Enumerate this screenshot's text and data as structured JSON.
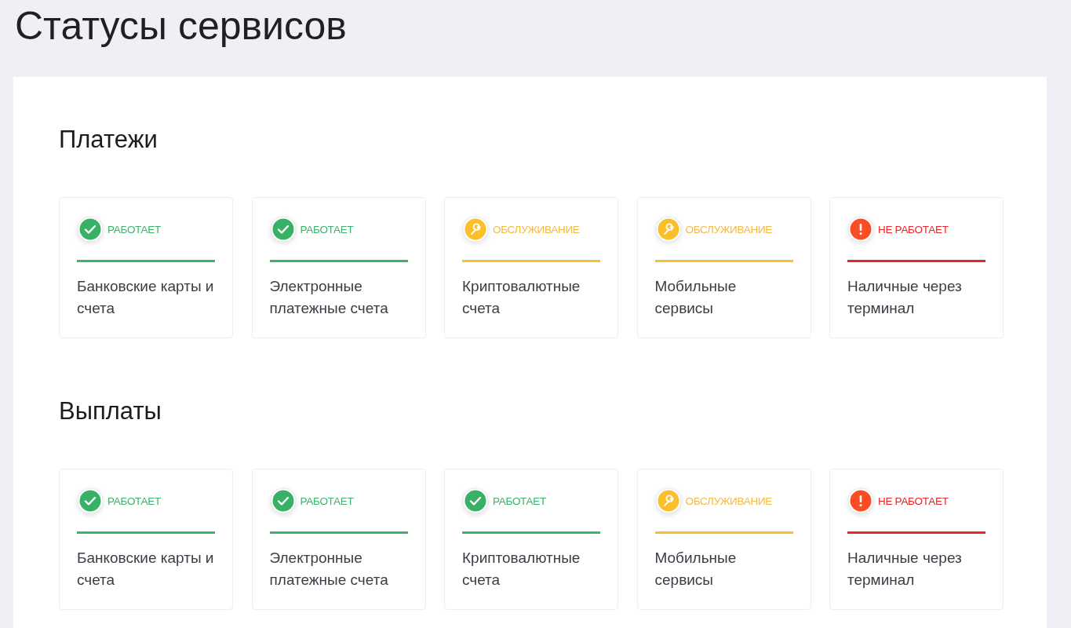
{
  "title": "Статусы сервисов",
  "sections": [
    {
      "title": "Платежи",
      "services": [
        {
          "kind": "ok",
          "status": "РАБОТАЕТ",
          "name": "Банковские карты и счета"
        },
        {
          "kind": "ok",
          "status": "РАБОТАЕТ",
          "name": "Электронные платежные счета"
        },
        {
          "kind": "maintenance",
          "status": "ОБСЛУЖИВАНИЕ",
          "name": "Криптовалютные счета"
        },
        {
          "kind": "maintenance",
          "status": "ОБСЛУЖИВАНИЕ",
          "name": "Мобильные сервисы"
        },
        {
          "kind": "down",
          "status": "НЕ РАБОТАЕТ",
          "name": "Наличные через терминал"
        }
      ]
    },
    {
      "title": "Выплаты",
      "services": [
        {
          "kind": "ok",
          "status": "РАБОТАЕТ",
          "name": "Банковские карты и счета"
        },
        {
          "kind": "ok",
          "status": "РАБОТАЕТ",
          "name": "Электронные платежные счета"
        },
        {
          "kind": "ok",
          "status": "РАБОТАЕТ",
          "name": "Криптовалютные счета"
        },
        {
          "kind": "maintenance",
          "status": "ОБСЛУЖИВАНИЕ",
          "name": "Мобильные сервисы"
        },
        {
          "kind": "down",
          "status": "НЕ РАБОТАЕТ",
          "name": "Наличные через терминал"
        }
      ]
    }
  ]
}
